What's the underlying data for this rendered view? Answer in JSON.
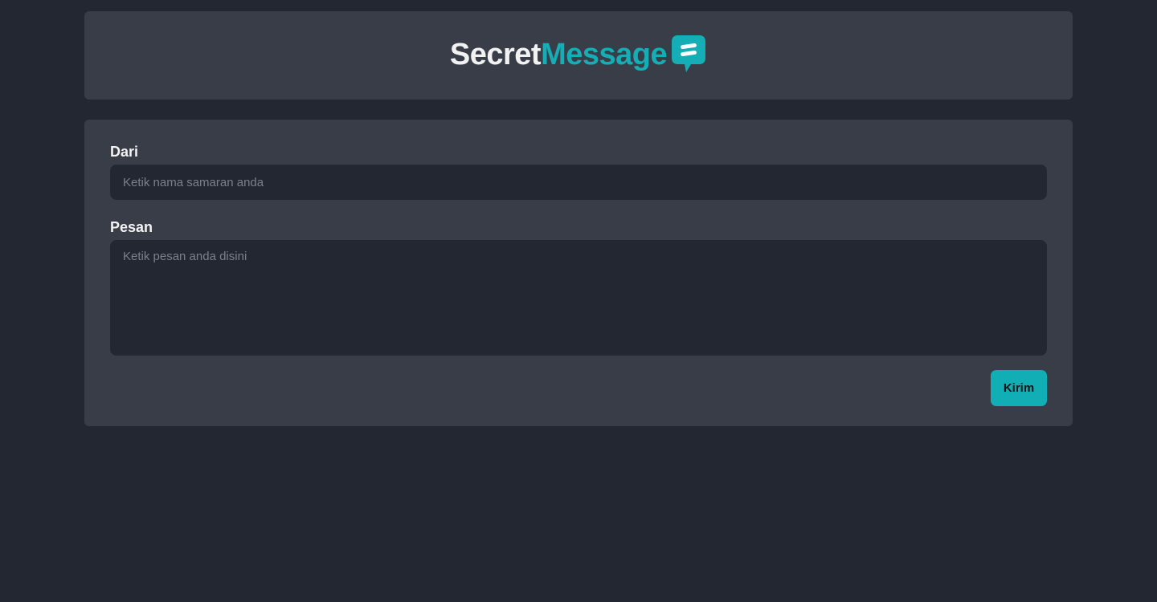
{
  "header": {
    "logo_part1": "Secret",
    "logo_part2": "Message",
    "logo_icon": "chat-bubble-icon"
  },
  "form": {
    "from_label": "Dari",
    "from_placeholder": "Ketik nama samaran anda",
    "from_value": "",
    "message_label": "Pesan",
    "message_placeholder": "Ketik pesan anda disini",
    "message_value": "",
    "submit_label": "Kirim"
  },
  "colors": {
    "background": "#222731",
    "card": "#393d47",
    "accent": "#16aeb6",
    "text": "#f3f3f3"
  }
}
